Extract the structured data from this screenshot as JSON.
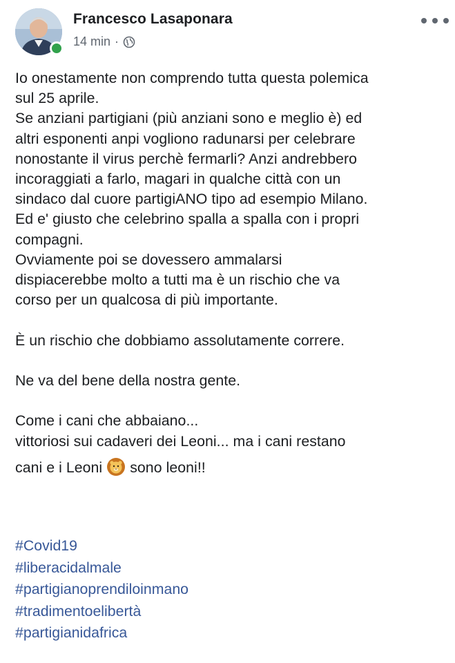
{
  "post": {
    "author": "Francesco Lasaponara",
    "timestamp": "14 min",
    "separator": "·",
    "privacy_icon": "globe-icon",
    "online_status_color": "#31a24c",
    "more_icon": "more-horizontal-icon"
  },
  "body": {
    "para1": [
      "Io onestamente non comprendo tutta questa polemica",
      "sul 25 aprile.",
      "Se anziani partigiani (più anziani sono e meglio è) ed",
      "altri esponenti anpi vogliono radunarsi per celebrare",
      "nonostante il virus perchè fermarli? Anzi andrebbero",
      "incoraggiati a farlo, magari in qualche città con un",
      "sindaco dal cuore partigiANO tipo ad esempio Milano.",
      "Ed e' giusto che celebrino spalla a spalla con i propri",
      "compagni.",
      "Ovviamente poi se dovessero ammalarsi",
      "dispiacerebbe molto a tutti ma è un rischio che va",
      "corso per un qualcosa di più importante."
    ],
    "para2": "È un rischio che dobbiamo assolutamente correre.",
    "para3": "Ne va del bene della nostra gente.",
    "para4_line1": "Come i cani che abbaiano...",
    "para4_line2": "vittoriosi sui cadaveri dei Leoni... ma i cani restano",
    "para4_line3_before": "cani e i Leoni",
    "para4_emoji": "lion-face-emoji",
    "para4_line3_after": "sono leoni!!"
  },
  "hashtags": [
    "#Covid19",
    "#liberacidalmale",
    "#partigianoprendiloinmano",
    "#tradimentoelibertà",
    "#partigianidafrica"
  ],
  "colors": {
    "text": "#1c1e21",
    "secondary": "#606770",
    "hashtag": "#385898"
  }
}
